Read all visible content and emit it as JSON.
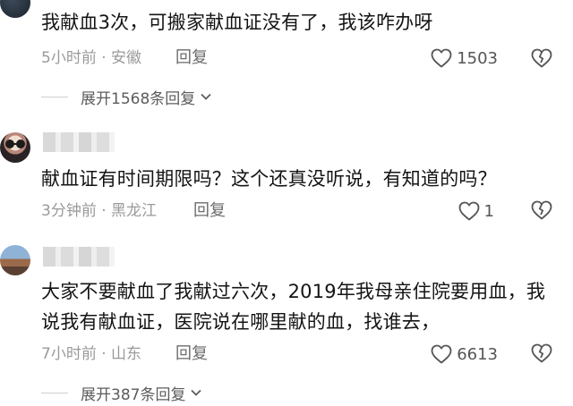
{
  "comments": [
    {
      "text": "我献血3次，可搬家献血证没有了，我该咋办呀",
      "meta": "5小时前 · 安徽",
      "reply_label": "回复",
      "likes": "1503",
      "expand_label": "展开1568条回复"
    },
    {
      "text": "献血证有时间期限吗？这个还真没听说，有知道的吗？",
      "meta": "3分钟前 · 黑龙江",
      "reply_label": "回复",
      "likes": "1"
    },
    {
      "text": "大家不要献血了我献过六次，2019年我母亲住院要用血，我说我有献血证，医院说在哪里献的血，找谁去，",
      "meta": "7小时前 · 山东",
      "reply_label": "回复",
      "likes": "6613",
      "expand_label": "展开387条回复"
    }
  ],
  "icons": {
    "like": "heart-outline-icon",
    "dislike": "broken-heart-icon",
    "expand": "chevron-down-icon"
  },
  "colors": {
    "text": "#141414",
    "meta": "#9a9a9a",
    "icon": "#555555"
  }
}
